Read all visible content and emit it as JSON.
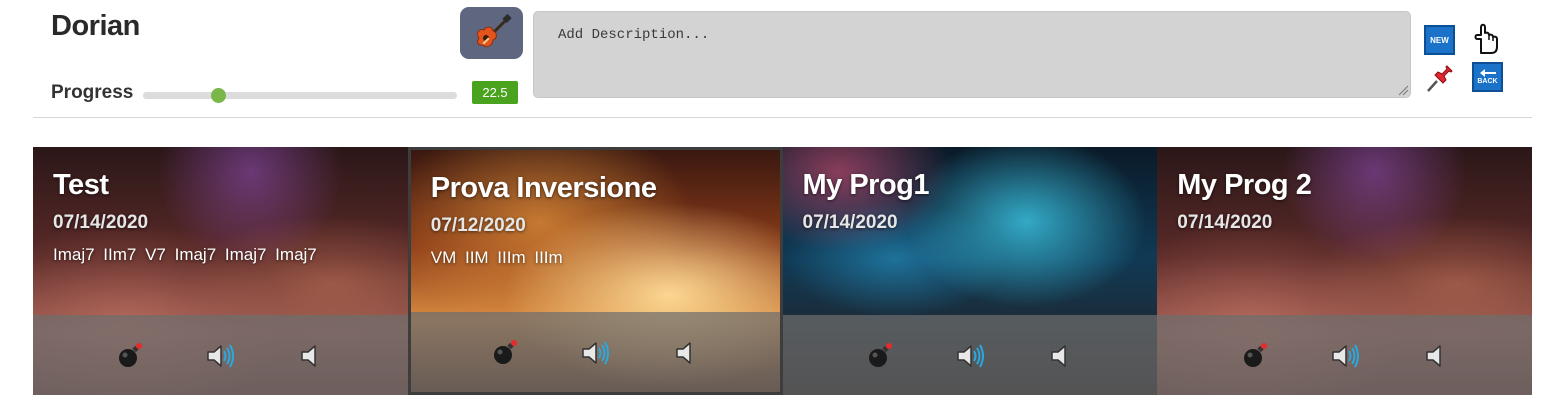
{
  "header": {
    "title": "Dorian",
    "progress_label": "Progress",
    "progress_value": "22.5",
    "progress_fraction": 0.24,
    "description_placeholder": "Add Description...",
    "new_label": "NEW",
    "back_label": "BACK"
  },
  "colors": {
    "progress_badge": "#4aa31e",
    "slider_thumb": "#7ab648",
    "guitar_button": "#5f6680",
    "badge_blue": "#1a73c9"
  },
  "cards": [
    {
      "title": "Test",
      "date": "07/14/2020",
      "chords": "Imaj7  IIm7  V7  Imaj7  Imaj7  Imaj7",
      "selected": false
    },
    {
      "title": "Prova Inversione",
      "date": "07/12/2020",
      "chords": "VM  IIM  IIIm  IIIm",
      "selected": true
    },
    {
      "title": "My Prog1",
      "date": "07/14/2020",
      "chords": "",
      "selected": false
    },
    {
      "title": "My Prog 2",
      "date": "07/14/2020",
      "chords": "",
      "selected": false
    }
  ],
  "icons": {
    "guitar": "guitar-icon",
    "new": "new-icon",
    "hand": "pointing-hand-icon",
    "pin": "pushpin-icon",
    "back": "back-icon",
    "bomb": "bomb-icon",
    "speaker_on": "speaker-loud-icon",
    "speaker_off": "speaker-mute-icon"
  }
}
